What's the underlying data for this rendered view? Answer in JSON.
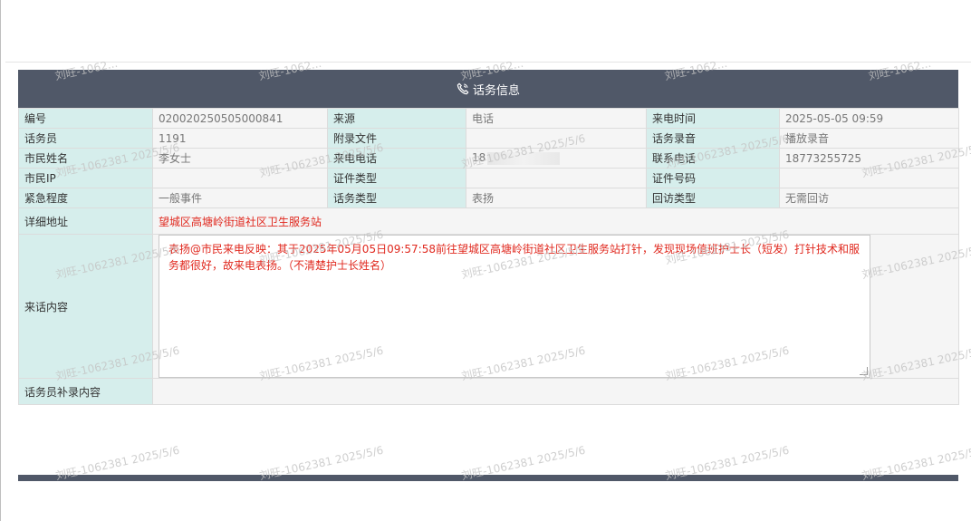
{
  "header": {
    "title": "话务信息",
    "icon": "phone-icon"
  },
  "rows": {
    "r1": {
      "l1": "编号",
      "v1": "020020250505000841",
      "l2": "来源",
      "v2": "电话",
      "l3": "来电时间",
      "v3": "2025-05-05 09:59"
    },
    "r2": {
      "l1": "话务员",
      "v1": "1191",
      "l2": "附录文件",
      "v2": "",
      "l3": "话务录音",
      "v3": "播放录音"
    },
    "r3": {
      "l1": "市民姓名",
      "v1": "李女士",
      "l2": "来电电话",
      "v2": "18",
      "l3": "联系电话",
      "v3": "18773255725"
    },
    "r4": {
      "l1": "市民IP",
      "v1": "",
      "l2": "证件类型",
      "v2": "",
      "l3": "证件号码",
      "v3": ""
    },
    "r5": {
      "l1": "紧急程度",
      "v1": "一般事件",
      "l2": "话务类型",
      "v2": "表扬",
      "l3": "回访类型",
      "v3": "无需回访"
    }
  },
  "address": {
    "label": "详细地址",
    "value": "望城区高塘岭街道社区卫生服务站"
  },
  "content": {
    "label": "来话内容",
    "text": "表扬@市民来电反映：其于2025年05月05日09:57:58前往望城区高塘岭街道社区卫生服务站打针，发现现场值班护士长（短发）打针技术和服务都很好，故来电表扬。（不清楚护士长姓名）"
  },
  "supplement": {
    "label": "话务员补录内容",
    "value": ""
  },
  "watermarks": {
    "partial": "刘旺-1062...",
    "full": "刘旺-1062381 2025/5/6"
  },
  "colors": {
    "header_bg": "#505868",
    "label_bg": "#d6eeec",
    "value_bg": "#f5f5f5",
    "accent_red": "#e0281e"
  }
}
